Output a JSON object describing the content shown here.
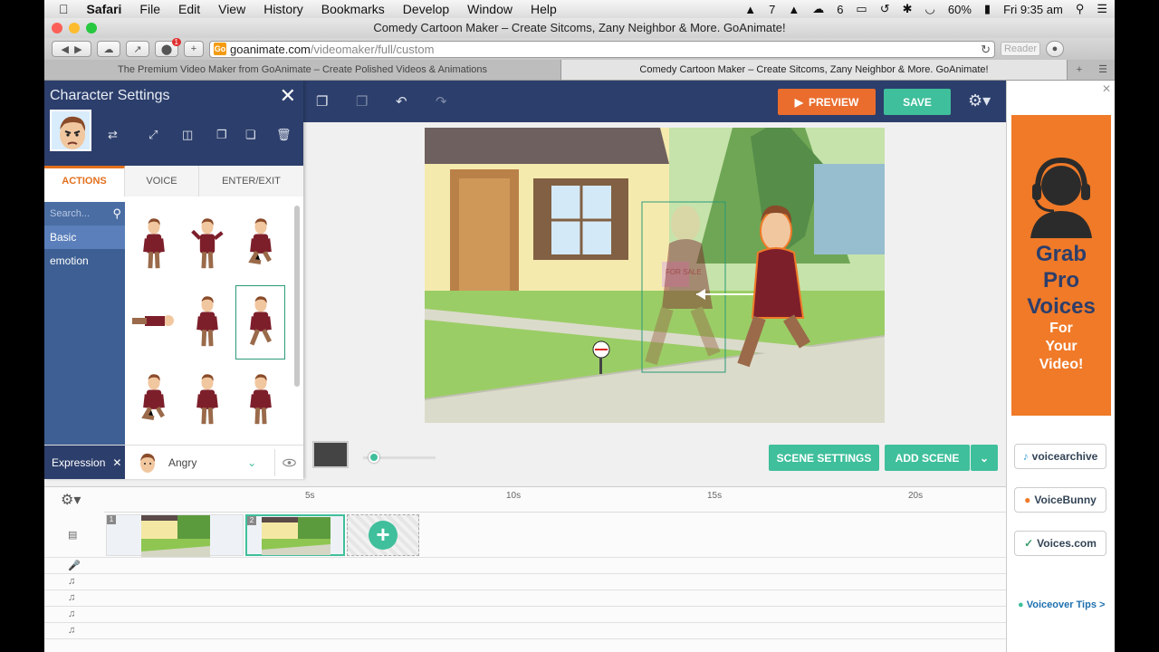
{
  "menubar": {
    "items": [
      "Safari",
      "File",
      "Edit",
      "View",
      "History",
      "Bookmarks",
      "Develop",
      "Window",
      "Help"
    ],
    "status_number": "7",
    "status_number2": "6",
    "battery": "60%",
    "clock": "Fri 9:35 am"
  },
  "window": {
    "title": "Comedy Cartoon Maker – Create Sitcoms, Zany Neighbor & More. GoAnimate!"
  },
  "toolbar": {
    "badge": "1",
    "url_domain": "goanimate.com",
    "url_path": "/videomaker/full/custom",
    "reader": "Reader",
    "favicon": "Go"
  },
  "tabs": [
    "The Premium Video Maker from GoAnimate – Create Polished Videos & Animations",
    "Comedy Cartoon Maker – Create Sitcoms, Zany Neighbor & More. GoAnimate!"
  ],
  "app": {
    "preview_label": "PREVIEW",
    "save_label": "SAVE",
    "panel": {
      "title": "Character Settings",
      "tabs": [
        "ACTIONS",
        "VOICE",
        "ENTER/EXIT"
      ],
      "search_placeholder": "Search...",
      "categories": [
        "Basic",
        "emotion"
      ],
      "expression_label": "Expression",
      "expression_value": "Angry"
    },
    "stage": {
      "sign_text": "FOR SALE",
      "measure": "100px"
    },
    "scene_settings_label": "SCENE SETTINGS",
    "add_scene_label": "ADD SCENE",
    "timeline": {
      "ticks": [
        "5s",
        "10s",
        "15s",
        "20s"
      ],
      "scene_numbers": [
        "1",
        "2"
      ]
    }
  },
  "ad": {
    "lines": [
      "Grab",
      "Pro",
      "Voices"
    ],
    "lines_small": [
      "For",
      "Your",
      "Video!"
    ],
    "logos": [
      "voicearchive",
      "VoiceBunny",
      "Voices.com"
    ],
    "tips": "Voiceover Tips >"
  }
}
